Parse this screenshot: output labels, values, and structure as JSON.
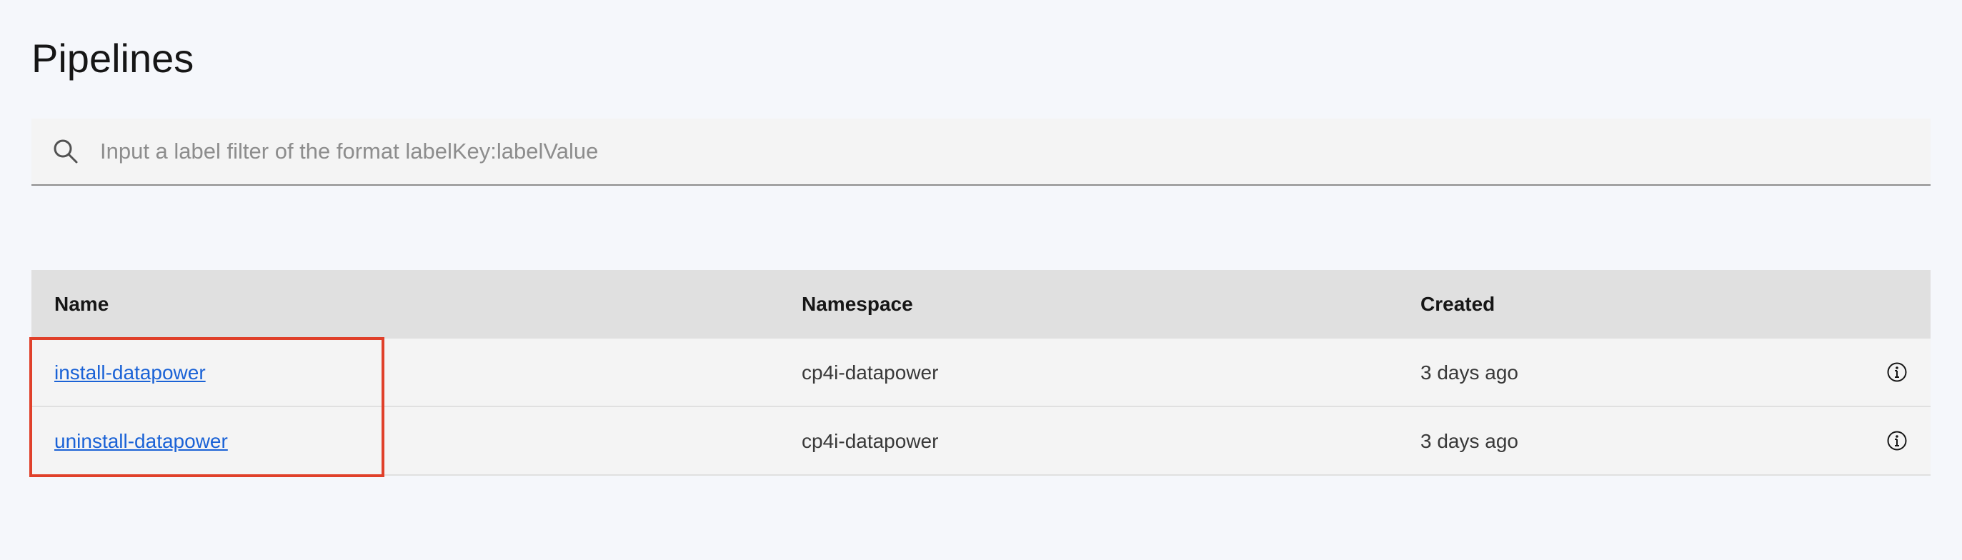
{
  "page": {
    "title": "Pipelines"
  },
  "search": {
    "placeholder": "Input a label filter of the format labelKey:labelValue",
    "value": "",
    "icon": "search-icon"
  },
  "table": {
    "columns": {
      "name": "Name",
      "namespace": "Namespace",
      "created": "Created"
    },
    "rows": [
      {
        "name": "install-datapower",
        "namespace": "cp4i-datapower",
        "created": "3 days ago",
        "icon": "info-icon"
      },
      {
        "name": "uninstall-datapower",
        "namespace": "cp4i-datapower",
        "created": "3 days ago",
        "icon": "info-icon"
      }
    ]
  },
  "colors": {
    "background": "#f5f7fb",
    "link": "#1a62d6",
    "header": "#e0e0e0",
    "row": "#f4f4f4",
    "highlight": "#e0402a"
  }
}
